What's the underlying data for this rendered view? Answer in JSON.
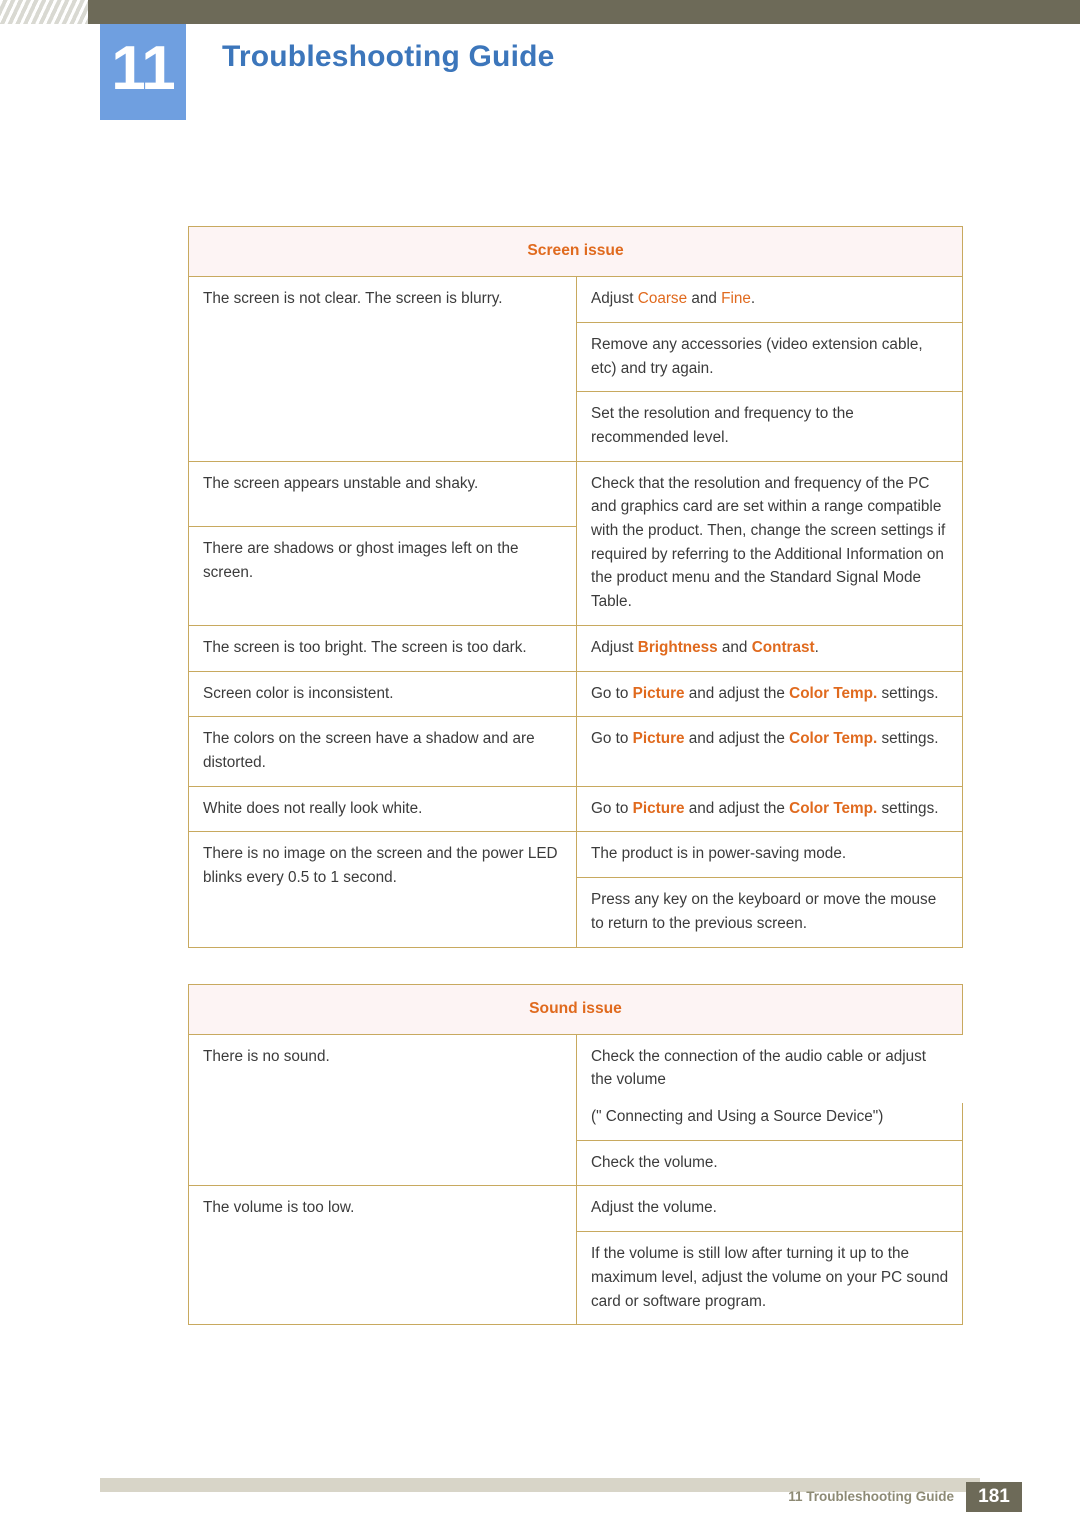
{
  "header": {
    "chapter_number": "11",
    "chapter_title": "Troubleshooting Guide"
  },
  "tables": [
    {
      "section_title": "Screen issue",
      "rows": [
        {
          "question": "The screen is not clear. The screen is blurry.",
          "answers": [
            {
              "segments": [
                {
                  "text": "Adjust ",
                  "style": "plain"
                },
                {
                  "text": "Coarse",
                  "style": "keyword-plain"
                },
                {
                  "text": " and ",
                  "style": "plain"
                },
                {
                  "text": "Fine",
                  "style": "keyword-plain"
                },
                {
                  "text": ".",
                  "style": "plain"
                }
              ]
            },
            {
              "segments": [
                {
                  "text": "Remove any accessories (video extension cable, etc) and try again.",
                  "style": "plain"
                }
              ]
            },
            {
              "segments": [
                {
                  "text": "Set the resolution and frequency to the recommended level.",
                  "style": "plain"
                }
              ]
            }
          ]
        },
        {
          "question": "The screen appears unstable and shaky.",
          "answers": []
        },
        {
          "question": "There are shadows or ghost images left on the screen.",
          "answers": [
            {
              "segments": [
                {
                  "text": "Check that the resolution and frequency of the PC and graphics card are set within a range compatible with the product. Then, change the screen settings if required by referring to the Additional Information on the product menu and the Standard Signal Mode Table.",
                  "style": "plain"
                }
              ]
            }
          ]
        },
        {
          "question": "The screen is too bright. The screen is too dark.",
          "answers": [
            {
              "segments": [
                {
                  "text": "Adjust ",
                  "style": "plain"
                },
                {
                  "text": "Brightness",
                  "style": "keyword"
                },
                {
                  "text": " and ",
                  "style": "plain"
                },
                {
                  "text": "Contrast",
                  "style": "keyword"
                },
                {
                  "text": ".",
                  "style": "plain"
                }
              ]
            }
          ]
        },
        {
          "question": "Screen color is inconsistent.",
          "answers": [
            {
              "segments": [
                {
                  "text": "Go to ",
                  "style": "plain"
                },
                {
                  "text": "Picture",
                  "style": "keyword"
                },
                {
                  "text": " and adjust the ",
                  "style": "plain"
                },
                {
                  "text": "Color Temp.",
                  "style": "keyword"
                },
                {
                  "text": " settings.",
                  "style": "plain"
                }
              ]
            }
          ]
        },
        {
          "question": "The colors on the screen have a shadow and are distorted.",
          "answers": [
            {
              "segments": [
                {
                  "text": "Go to ",
                  "style": "plain"
                },
                {
                  "text": "Picture",
                  "style": "keyword"
                },
                {
                  "text": " and adjust the ",
                  "style": "plain"
                },
                {
                  "text": "Color Temp.",
                  "style": "keyword"
                },
                {
                  "text": " settings.",
                  "style": "plain"
                }
              ]
            }
          ]
        },
        {
          "question": "White does not really look white.",
          "answers": [
            {
              "segments": [
                {
                  "text": "Go to ",
                  "style": "plain"
                },
                {
                  "text": "Picture",
                  "style": "keyword"
                },
                {
                  "text": " and adjust the ",
                  "style": "plain"
                },
                {
                  "text": "Color Temp.",
                  "style": "keyword"
                },
                {
                  "text": " settings.",
                  "style": "plain"
                }
              ]
            }
          ]
        },
        {
          "question": "There is no image on the screen and the power LED blinks every 0.5 to 1 second.",
          "answers": [
            {
              "segments": [
                {
                  "text": "The product is in power-saving mode.",
                  "style": "plain"
                }
              ]
            },
            {
              "segments": [
                {
                  "text": "Press any key on the keyboard or move the mouse to return to the previous screen.",
                  "style": "plain"
                }
              ]
            }
          ]
        }
      ]
    },
    {
      "section_title": "Sound issue",
      "rows": [
        {
          "question": "There is no sound.",
          "answers": [
            {
              "segments": [
                {
                  "text": "Check the connection of the audio cable or adjust the volume",
                  "style": "plain"
                }
              ]
            },
            {
              "segments": [
                {
                  "text": "(\" Connecting and Using a Source Device\")",
                  "style": "plain"
                }
              ]
            },
            {
              "segments": [
                {
                  "text": "Check the volume.",
                  "style": "plain"
                }
              ]
            }
          ]
        },
        {
          "question": "The volume is too low.",
          "answers": [
            {
              "segments": [
                {
                  "text": "Adjust the volume.",
                  "style": "plain"
                }
              ]
            },
            {
              "segments": [
                {
                  "text": "If the volume is still low after turning it up to the maximum level, adjust the volume on your PC sound card or software program.",
                  "style": "plain"
                }
              ]
            }
          ]
        }
      ]
    }
  ],
  "footer": {
    "text": "11 Troubleshooting Guide",
    "page_number": "181"
  },
  "colors": {
    "header_bar": "#6d6a58",
    "badge": "#6f9fe0",
    "title": "#3c76bb",
    "table_border": "#c8a95f",
    "section_head_bg": "#fdf4f4",
    "accent_orange": "#e06a1e",
    "footer_rule": "#d8d5c8"
  }
}
